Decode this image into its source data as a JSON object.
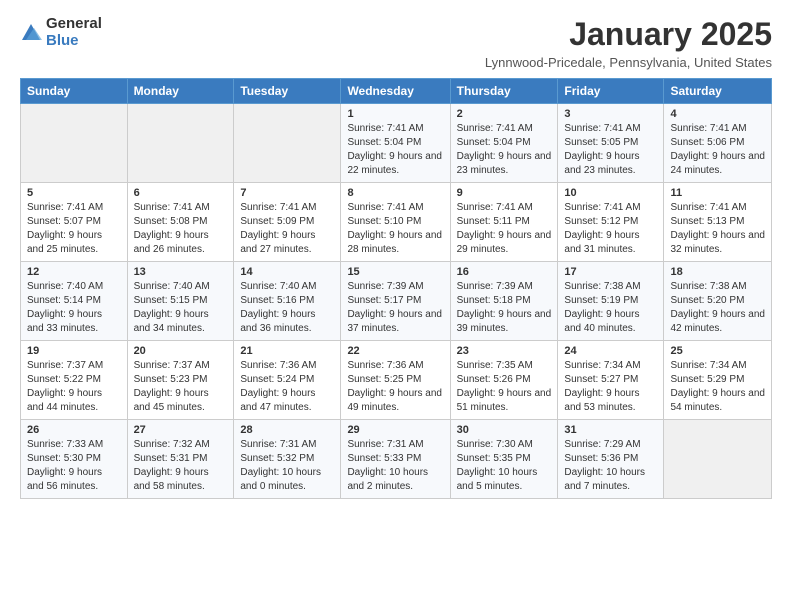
{
  "logo": {
    "general": "General",
    "blue": "Blue"
  },
  "title": "January 2025",
  "location": "Lynnwood-Pricedale, Pennsylvania, United States",
  "days_header": [
    "Sunday",
    "Monday",
    "Tuesday",
    "Wednesday",
    "Thursday",
    "Friday",
    "Saturday"
  ],
  "weeks": [
    [
      {
        "day": "",
        "sunrise": "",
        "sunset": "",
        "daylight": ""
      },
      {
        "day": "",
        "sunrise": "",
        "sunset": "",
        "daylight": ""
      },
      {
        "day": "",
        "sunrise": "",
        "sunset": "",
        "daylight": ""
      },
      {
        "day": "1",
        "sunrise": "Sunrise: 7:41 AM",
        "sunset": "Sunset: 5:04 PM",
        "daylight": "Daylight: 9 hours and 22 minutes."
      },
      {
        "day": "2",
        "sunrise": "Sunrise: 7:41 AM",
        "sunset": "Sunset: 5:04 PM",
        "daylight": "Daylight: 9 hours and 23 minutes."
      },
      {
        "day": "3",
        "sunrise": "Sunrise: 7:41 AM",
        "sunset": "Sunset: 5:05 PM",
        "daylight": "Daylight: 9 hours and 23 minutes."
      },
      {
        "day": "4",
        "sunrise": "Sunrise: 7:41 AM",
        "sunset": "Sunset: 5:06 PM",
        "daylight": "Daylight: 9 hours and 24 minutes."
      }
    ],
    [
      {
        "day": "5",
        "sunrise": "Sunrise: 7:41 AM",
        "sunset": "Sunset: 5:07 PM",
        "daylight": "Daylight: 9 hours and 25 minutes."
      },
      {
        "day": "6",
        "sunrise": "Sunrise: 7:41 AM",
        "sunset": "Sunset: 5:08 PM",
        "daylight": "Daylight: 9 hours and 26 minutes."
      },
      {
        "day": "7",
        "sunrise": "Sunrise: 7:41 AM",
        "sunset": "Sunset: 5:09 PM",
        "daylight": "Daylight: 9 hours and 27 minutes."
      },
      {
        "day": "8",
        "sunrise": "Sunrise: 7:41 AM",
        "sunset": "Sunset: 5:10 PM",
        "daylight": "Daylight: 9 hours and 28 minutes."
      },
      {
        "day": "9",
        "sunrise": "Sunrise: 7:41 AM",
        "sunset": "Sunset: 5:11 PM",
        "daylight": "Daylight: 9 hours and 29 minutes."
      },
      {
        "day": "10",
        "sunrise": "Sunrise: 7:41 AM",
        "sunset": "Sunset: 5:12 PM",
        "daylight": "Daylight: 9 hours and 31 minutes."
      },
      {
        "day": "11",
        "sunrise": "Sunrise: 7:41 AM",
        "sunset": "Sunset: 5:13 PM",
        "daylight": "Daylight: 9 hours and 32 minutes."
      }
    ],
    [
      {
        "day": "12",
        "sunrise": "Sunrise: 7:40 AM",
        "sunset": "Sunset: 5:14 PM",
        "daylight": "Daylight: 9 hours and 33 minutes."
      },
      {
        "day": "13",
        "sunrise": "Sunrise: 7:40 AM",
        "sunset": "Sunset: 5:15 PM",
        "daylight": "Daylight: 9 hours and 34 minutes."
      },
      {
        "day": "14",
        "sunrise": "Sunrise: 7:40 AM",
        "sunset": "Sunset: 5:16 PM",
        "daylight": "Daylight: 9 hours and 36 minutes."
      },
      {
        "day": "15",
        "sunrise": "Sunrise: 7:39 AM",
        "sunset": "Sunset: 5:17 PM",
        "daylight": "Daylight: 9 hours and 37 minutes."
      },
      {
        "day": "16",
        "sunrise": "Sunrise: 7:39 AM",
        "sunset": "Sunset: 5:18 PM",
        "daylight": "Daylight: 9 hours and 39 minutes."
      },
      {
        "day": "17",
        "sunrise": "Sunrise: 7:38 AM",
        "sunset": "Sunset: 5:19 PM",
        "daylight": "Daylight: 9 hours and 40 minutes."
      },
      {
        "day": "18",
        "sunrise": "Sunrise: 7:38 AM",
        "sunset": "Sunset: 5:20 PM",
        "daylight": "Daylight: 9 hours and 42 minutes."
      }
    ],
    [
      {
        "day": "19",
        "sunrise": "Sunrise: 7:37 AM",
        "sunset": "Sunset: 5:22 PM",
        "daylight": "Daylight: 9 hours and 44 minutes."
      },
      {
        "day": "20",
        "sunrise": "Sunrise: 7:37 AM",
        "sunset": "Sunset: 5:23 PM",
        "daylight": "Daylight: 9 hours and 45 minutes."
      },
      {
        "day": "21",
        "sunrise": "Sunrise: 7:36 AM",
        "sunset": "Sunset: 5:24 PM",
        "daylight": "Daylight: 9 hours and 47 minutes."
      },
      {
        "day": "22",
        "sunrise": "Sunrise: 7:36 AM",
        "sunset": "Sunset: 5:25 PM",
        "daylight": "Daylight: 9 hours and 49 minutes."
      },
      {
        "day": "23",
        "sunrise": "Sunrise: 7:35 AM",
        "sunset": "Sunset: 5:26 PM",
        "daylight": "Daylight: 9 hours and 51 minutes."
      },
      {
        "day": "24",
        "sunrise": "Sunrise: 7:34 AM",
        "sunset": "Sunset: 5:27 PM",
        "daylight": "Daylight: 9 hours and 53 minutes."
      },
      {
        "day": "25",
        "sunrise": "Sunrise: 7:34 AM",
        "sunset": "Sunset: 5:29 PM",
        "daylight": "Daylight: 9 hours and 54 minutes."
      }
    ],
    [
      {
        "day": "26",
        "sunrise": "Sunrise: 7:33 AM",
        "sunset": "Sunset: 5:30 PM",
        "daylight": "Daylight: 9 hours and 56 minutes."
      },
      {
        "day": "27",
        "sunrise": "Sunrise: 7:32 AM",
        "sunset": "Sunset: 5:31 PM",
        "daylight": "Daylight: 9 hours and 58 minutes."
      },
      {
        "day": "28",
        "sunrise": "Sunrise: 7:31 AM",
        "sunset": "Sunset: 5:32 PM",
        "daylight": "Daylight: 10 hours and 0 minutes."
      },
      {
        "day": "29",
        "sunrise": "Sunrise: 7:31 AM",
        "sunset": "Sunset: 5:33 PM",
        "daylight": "Daylight: 10 hours and 2 minutes."
      },
      {
        "day": "30",
        "sunrise": "Sunrise: 7:30 AM",
        "sunset": "Sunset: 5:35 PM",
        "daylight": "Daylight: 10 hours and 5 minutes."
      },
      {
        "day": "31",
        "sunrise": "Sunrise: 7:29 AM",
        "sunset": "Sunset: 5:36 PM",
        "daylight": "Daylight: 10 hours and 7 minutes."
      },
      {
        "day": "",
        "sunrise": "",
        "sunset": "",
        "daylight": ""
      }
    ]
  ]
}
